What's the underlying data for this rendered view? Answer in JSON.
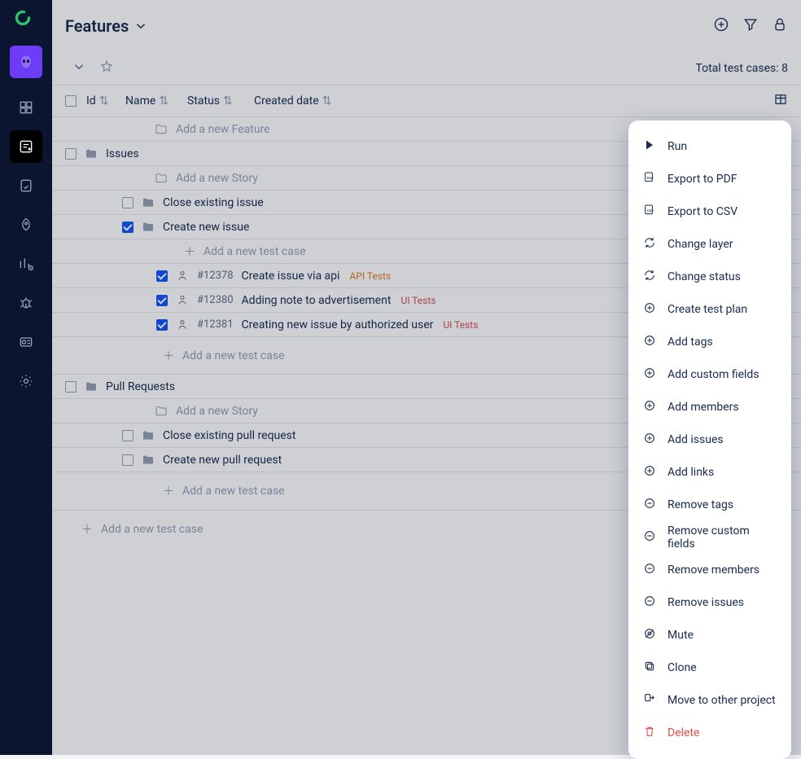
{
  "header": {
    "title": "Features",
    "total_label": "Total test cases: 8"
  },
  "columns": {
    "id": "Id",
    "name": "Name",
    "status": "Status",
    "created_date": "Created date"
  },
  "tree": {
    "add_feature": "Add a new Feature",
    "features": [
      {
        "name": "Issues",
        "add_story": "Add a new Story",
        "stories": [
          {
            "name": "Close existing issue",
            "checked": false,
            "cases": [],
            "add_case": null
          },
          {
            "name": "Create new issue",
            "checked": true,
            "add_case": "Add a new test case",
            "cases": [
              {
                "id": "#12378",
                "title": "Create issue via api",
                "tag": "API Tests",
                "tag_type": "api"
              },
              {
                "id": "#12380",
                "title": "Adding note to advertisement",
                "tag": "UI Tests",
                "tag_type": "ui"
              },
              {
                "id": "#12381",
                "title": "Creating new issue by authorized user",
                "tag": "UI Tests",
                "tag_type": "ui"
              }
            ]
          }
        ],
        "add_case_bottom": "Add a new test case"
      },
      {
        "name": "Pull Requests",
        "add_story": "Add a new Story",
        "stories": [
          {
            "name": "Close existing pull request",
            "checked": false,
            "cases": [],
            "add_case": null
          },
          {
            "name": "Create new pull request",
            "checked": false,
            "cases": [],
            "add_case": null
          }
        ],
        "add_case_bottom": "Add a new test case"
      }
    ],
    "root_add_case": "Add a new test case"
  },
  "context_menu": {
    "items": [
      {
        "key": "run",
        "label": "Run",
        "icon": "play"
      },
      {
        "key": "export-pdf",
        "label": "Export to PDF",
        "icon": "pdf"
      },
      {
        "key": "export-csv",
        "label": "Export to CSV",
        "icon": "csv"
      },
      {
        "key": "change-layer",
        "label": "Change layer",
        "icon": "refresh"
      },
      {
        "key": "change-status",
        "label": "Change status",
        "icon": "refresh"
      },
      {
        "key": "create-test-plan",
        "label": "Create test plan",
        "icon": "plus-circle"
      },
      {
        "key": "add-tags",
        "label": "Add tags",
        "icon": "plus-circle"
      },
      {
        "key": "add-custom-fields",
        "label": "Add custom fields",
        "icon": "plus-circle"
      },
      {
        "key": "add-members",
        "label": "Add members",
        "icon": "plus-circle"
      },
      {
        "key": "add-issues",
        "label": "Add issues",
        "icon": "plus-circle"
      },
      {
        "key": "add-links",
        "label": "Add links",
        "icon": "plus-circle"
      },
      {
        "key": "remove-tags",
        "label": "Remove tags",
        "icon": "minus-circle"
      },
      {
        "key": "remove-custom-fields",
        "label": "Remove custom fields",
        "icon": "minus-circle"
      },
      {
        "key": "remove-members",
        "label": "Remove members",
        "icon": "minus-circle"
      },
      {
        "key": "remove-issues",
        "label": "Remove issues",
        "icon": "minus-circle"
      },
      {
        "key": "mute",
        "label": "Mute",
        "icon": "mute"
      },
      {
        "key": "clone",
        "label": "Clone",
        "icon": "clone"
      },
      {
        "key": "move",
        "label": "Move to other project",
        "icon": "move"
      },
      {
        "key": "delete",
        "label": "Delete",
        "icon": "trash",
        "danger": true
      }
    ]
  }
}
